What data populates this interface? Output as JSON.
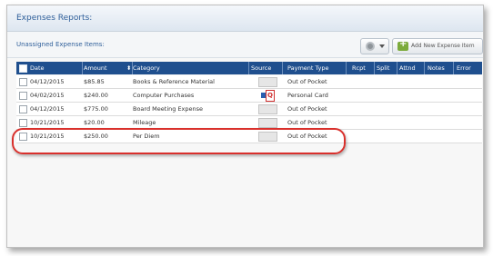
{
  "panel": {
    "title": "Expenses Reports:"
  },
  "subheader": {
    "title": "Unassigned Expense Items:",
    "add_button_label": "Add New Expense Item"
  },
  "icons": {
    "gear": "gear-icon",
    "add": "add-expense-icon",
    "source_receipt": "receipt-icon",
    "source_card": "card-icon"
  },
  "colors": {
    "header_bg": "#1f4f8e",
    "highlight": "#d9302c"
  },
  "table": {
    "headers": {
      "date": "Date",
      "amount": "Amount",
      "category": "Category",
      "source": "Source",
      "payment_type": "Payment Type",
      "rcpt": "Rcpt",
      "split": "Split",
      "attnd": "Attnd",
      "notes": "Notes",
      "error": "Error"
    },
    "rows": [
      {
        "date": "04/12/2015",
        "amount": "$85.85",
        "category": "Books & Reference Material",
        "source": "receipt",
        "payment_type": "Out of Pocket"
      },
      {
        "date": "04/02/2015",
        "amount": "$240.00",
        "category": "Computer Purchases",
        "source": "card",
        "payment_type": "Personal Card"
      },
      {
        "date": "04/12/2015",
        "amount": "$775.00",
        "category": "Board Meeting Expense",
        "source": "receipt",
        "payment_type": "Out of Pocket"
      },
      {
        "date": "10/21/2015",
        "amount": "$20.00",
        "category": "Mileage",
        "source": "receipt",
        "payment_type": "Out of Pocket"
      },
      {
        "date": "10/21/2015",
        "amount": "$250.00",
        "category": "Per Diem",
        "source": "receipt",
        "payment_type": "Out of Pocket"
      }
    ]
  }
}
